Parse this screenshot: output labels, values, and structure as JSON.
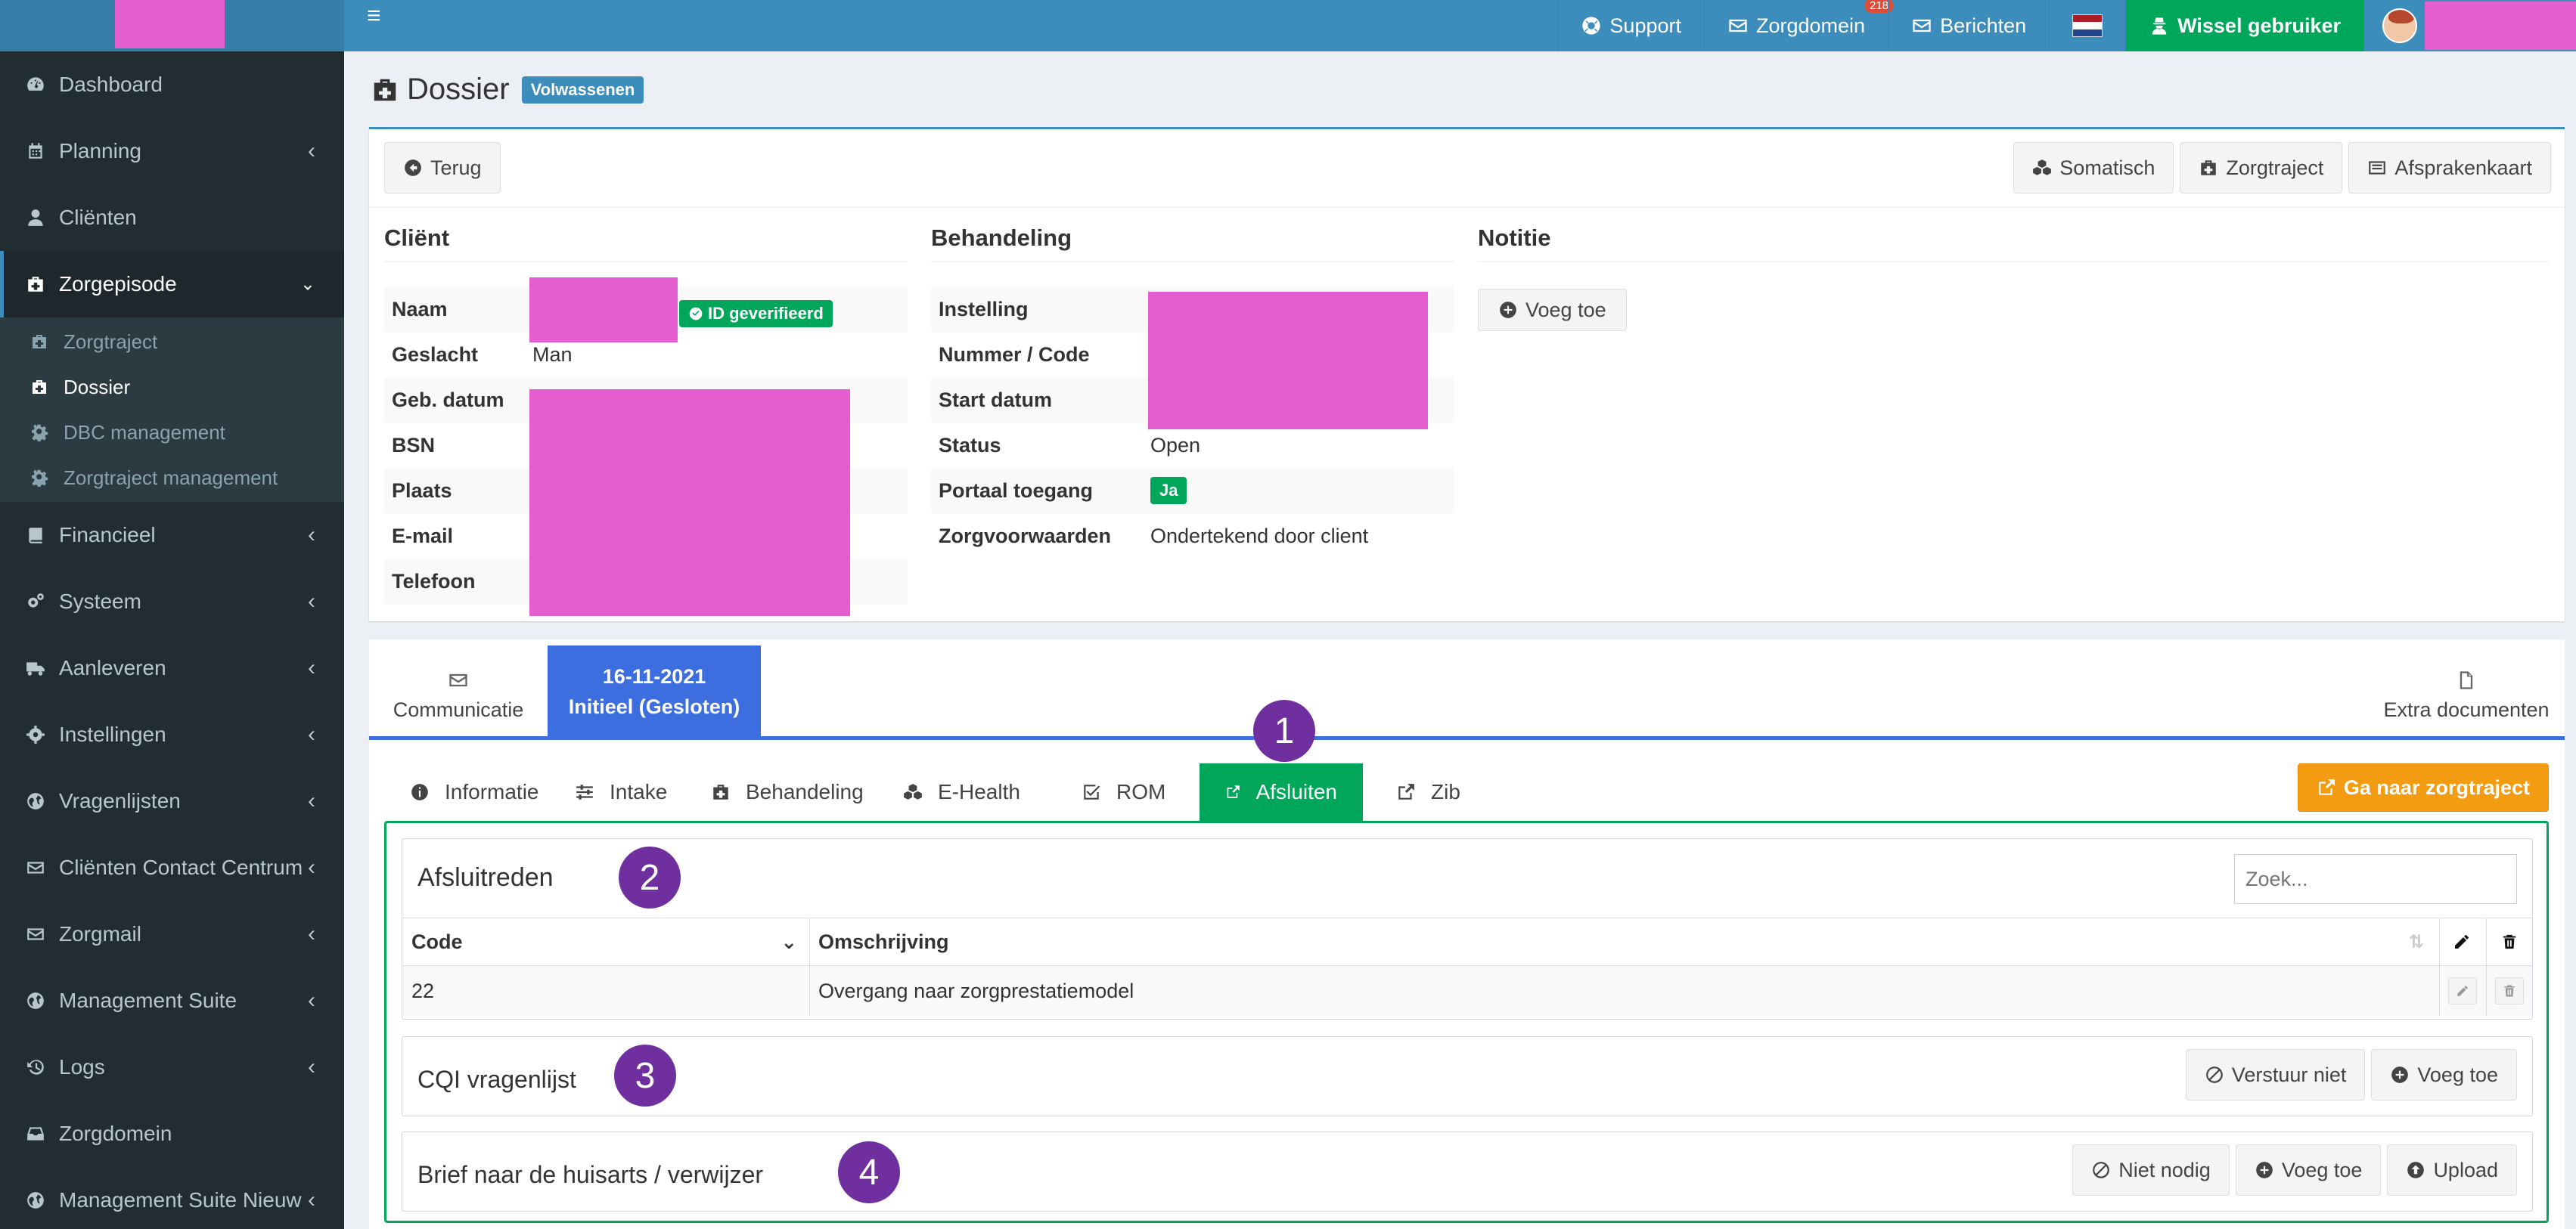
{
  "topbar": {
    "support": "Support",
    "zorgdomein": "Zorgdomein",
    "zorgdomein_badge": "218",
    "berichten": "Berichten",
    "switch_user": "Wissel gebruiker"
  },
  "sidebar": {
    "items": [
      {
        "label": "Dashboard",
        "icon": "dashboard-icon"
      },
      {
        "label": "Planning",
        "icon": "calendar-icon"
      },
      {
        "label": "Cliënten",
        "icon": "user-icon"
      },
      {
        "label": "Zorgepisode",
        "icon": "medkit-icon"
      },
      {
        "label": "Financieel",
        "icon": "book-icon"
      },
      {
        "label": "Systeem",
        "icon": "cogs-icon"
      },
      {
        "label": "Aanleveren",
        "icon": "truck-icon"
      },
      {
        "label": "Instellingen",
        "icon": "gear-icon"
      },
      {
        "label": "Vragenlijsten",
        "icon": "globe-icon"
      },
      {
        "label": "Cliënten Contact Centrum",
        "icon": "envelope-icon"
      },
      {
        "label": "Zorgmail",
        "icon": "envelope-icon"
      },
      {
        "label": "Management Suite",
        "icon": "globe-icon"
      },
      {
        "label": "Logs",
        "icon": "history-icon"
      },
      {
        "label": "Zorgdomein",
        "icon": "inbox-icon"
      },
      {
        "label": "Management Suite Nieuw",
        "icon": "globe-icon"
      }
    ],
    "subitems": [
      {
        "label": "Zorgtraject"
      },
      {
        "label": "Dossier"
      },
      {
        "label": "DBC management"
      },
      {
        "label": "Zorgtraject management"
      }
    ]
  },
  "page": {
    "title": "Dossier",
    "badge": "Volwassenen",
    "back_button": "Terug",
    "somatisch_button": "Somatisch",
    "zorgtraject_button": "Zorgtraject",
    "afsprakenkaart_button": "Afsprakenkaart"
  },
  "client": {
    "title": "Cliënt",
    "fields": [
      {
        "label": "Naam",
        "value": ""
      },
      {
        "label": "Geslacht",
        "value": "Man"
      },
      {
        "label": "Geb. datum",
        "value": ""
      },
      {
        "label": "BSN",
        "value": ""
      },
      {
        "label": "Plaats",
        "value": ""
      },
      {
        "label": "E-mail",
        "value": ""
      },
      {
        "label": "Telefoon",
        "value": ""
      }
    ],
    "id_badge": "ID geverifieerd"
  },
  "behandeling": {
    "title": "Behandeling",
    "fields": [
      {
        "label": "Instelling",
        "value": ""
      },
      {
        "label": "Nummer / Code",
        "value": ""
      },
      {
        "label": "Start datum",
        "value": ""
      },
      {
        "label": "Status",
        "value": "Open"
      },
      {
        "label": "Portaal toegang",
        "value": "Ja"
      },
      {
        "label": "Zorgvoorwaarden",
        "value": "Ondertekend door client"
      }
    ]
  },
  "notitie": {
    "title": "Notitie",
    "add_button": "Voeg toe"
  },
  "tabs": {
    "communicatie": "Communicatie",
    "episode_date": "16-11-2021",
    "episode_label": "Initieel (Gesloten)",
    "extra_documenten": "Extra documenten",
    "subtabs": [
      "Informatie",
      "Intake",
      "Behandeling",
      "E-Health",
      "ROM",
      "Afsluiten",
      "Zib"
    ],
    "ga_naar_button": "Ga naar zorgtraject"
  },
  "afsluitreden": {
    "title": "Afsluitreden",
    "search_placeholder": "Zoek...",
    "col_code": "Code",
    "col_omschrijving": "Omschrijving",
    "rows": [
      {
        "code": "22",
        "omschrijving": "Overgang naar zorgprestatiemodel"
      }
    ]
  },
  "cqi": {
    "title": "CQI vragenlijst",
    "verstuur_niet": "Verstuur niet",
    "voeg_toe": "Voeg toe"
  },
  "brief": {
    "title": "Brief naar de huisarts / verwijzer",
    "niet_nodig": "Niet nodig",
    "voeg_toe": "Voeg toe",
    "upload": "Upload"
  },
  "annotations": [
    "1",
    "2",
    "3",
    "4"
  ],
  "colors": {
    "header_blue": "#3c8dbc",
    "sidebar_dark": "#222d32",
    "green": "#00a65a",
    "orange": "#f39c12",
    "tab_blue": "#3c6ee0",
    "annotation_purple": "#6f2f9f",
    "redaction": "#e55ecf"
  }
}
